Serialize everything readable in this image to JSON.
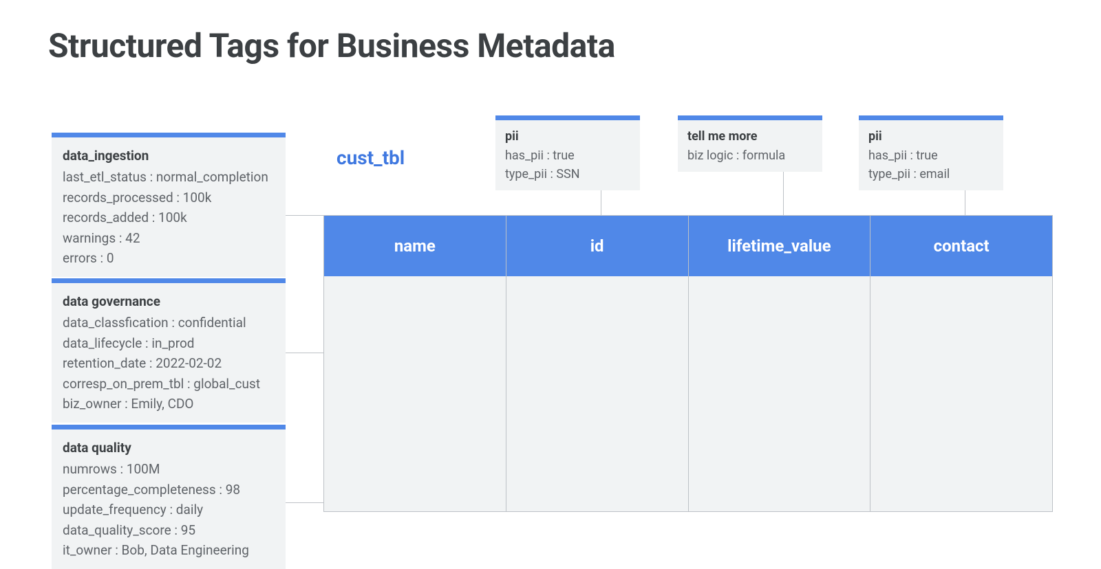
{
  "title": "Structured Tags for Business Metadata",
  "table_name": "cust_tbl",
  "side_tags": [
    {
      "title": "data_ingestion",
      "lines": [
        "last_etl_status : normal_completion",
        "records_processed : 100k",
        "records_added : 100k",
        "warnings : 42",
        "errors : 0"
      ]
    },
    {
      "title": "data governance",
      "lines": [
        "data_classfication : confidential",
        "data_lifecycle : in_prod",
        "retention_date : 2022-02-02",
        "corresp_on_prem_tbl : global_cust",
        "biz_owner : Emily, CDO"
      ]
    },
    {
      "title": "data quality",
      "lines": [
        "numrows : 100M",
        "percentage_completeness : 98",
        "update_frequency : daily",
        "data_quality_score : 95",
        "it_owner : Bob, Data Engineering"
      ]
    }
  ],
  "col_tags": [
    {
      "title": "pii",
      "lines": [
        "has_pii : true",
        "type_pii : SSN"
      ]
    },
    {
      "title": "tell me more",
      "lines": [
        "biz logic : formula"
      ]
    },
    {
      "title": "pii",
      "lines": [
        "has_pii : true",
        "type_pii : email"
      ]
    }
  ],
  "columns": [
    "name",
    "id",
    "lifetime_value",
    "contact"
  ]
}
